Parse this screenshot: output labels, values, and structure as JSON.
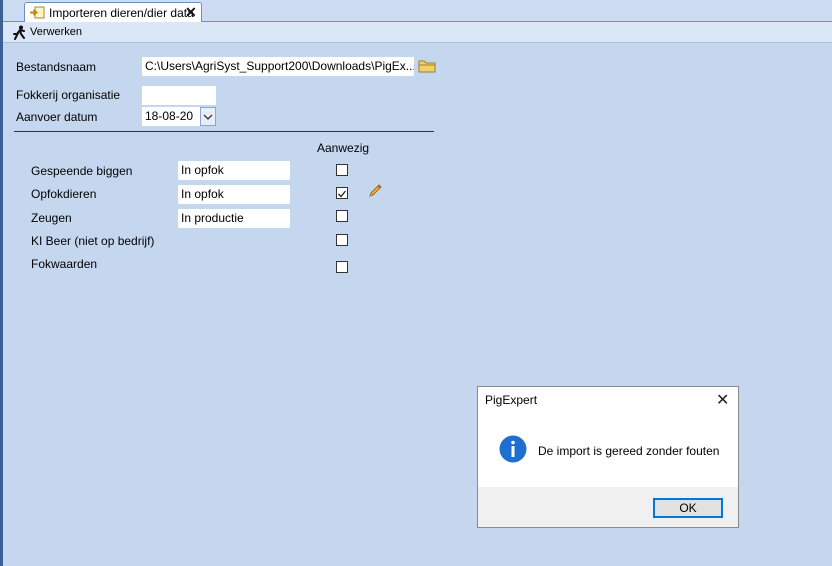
{
  "tab": {
    "title": "Importeren dieren/dier data",
    "close": "✕"
  },
  "toolbar": {
    "verwerken_label": "Verwerken"
  },
  "form": {
    "bestandsnaam_label": "Bestandsnaam",
    "bestandsnaam_value": "C:\\Users\\AgriSyst_Support200\\Downloads\\PigEx...",
    "fokkerij_label": "Fokkerij organisatie",
    "fokkerij_value": "",
    "aanvoer_label": "Aanvoer datum",
    "aanvoer_value": "18-08-20",
    "aanwezig_header": "Aanwezig"
  },
  "rows": [
    {
      "label": "Gespeende biggen",
      "status": "In opfok",
      "checked": false
    },
    {
      "label": "Opfokdieren",
      "status": "In opfok",
      "checked": true
    },
    {
      "label": "Zeugen",
      "status": "In productie",
      "checked": false
    },
    {
      "label": "KI Beer (niet op bedrijf)",
      "status": null,
      "checked": false
    },
    {
      "label": "Fokwaarden",
      "status": null,
      "checked": false
    }
  ],
  "dialog": {
    "title": "PigExpert",
    "close": "✕",
    "message": "De import is gereed zonder fouten",
    "ok_label": "OK",
    "icon": "info-icon"
  },
  "colors": {
    "background": "#c5d7ef",
    "accent": "#0078d7",
    "info_icon": "#1f6fd0"
  }
}
